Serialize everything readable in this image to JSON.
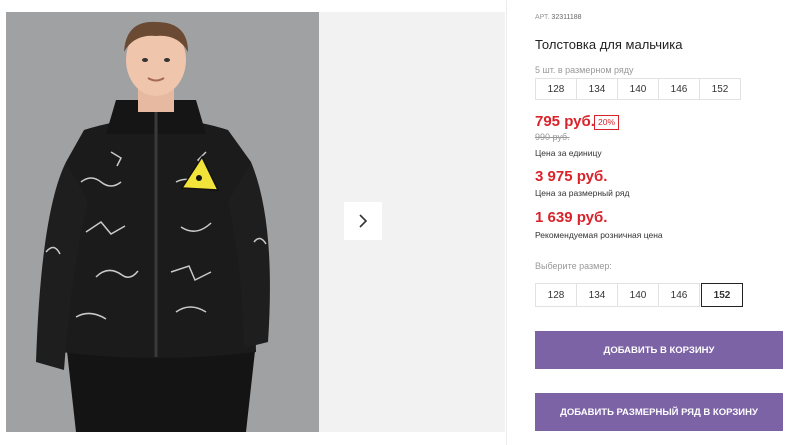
{
  "product": {
    "art_label": "АРТ.",
    "art_number": "32311188",
    "title": "Толстовка для мальчика",
    "row_note": "5 шт. в размерном ряду",
    "row_sizes": [
      "128",
      "134",
      "140",
      "146",
      "152"
    ],
    "unit_price": "795 руб.",
    "discount": "20%",
    "old_price": "990 руб.",
    "unit_price_caption": "Цена за единицу",
    "row_price": "3 975 руб.",
    "row_price_caption": "Цена за размерный ряд",
    "retail_price": "1 639 руб.",
    "retail_price_caption": "Рекомендуемая розничная цена",
    "choose_size_label": "Выберите размер:",
    "select_sizes": [
      "128",
      "134",
      "140",
      "146",
      "152"
    ],
    "selected_size": "152",
    "add_to_cart": "ДОБАВИТЬ В КОРЗИНУ",
    "add_row_to_cart": "ДОБАВИТЬ РАЗМЕРНЫЙ РЯД В КОРЗИНУ"
  },
  "gallery": {
    "next_icon": "chevron-right-icon",
    "photo_icon": "product-photo"
  },
  "colors": {
    "accent": "#7c63a6",
    "price_red": "#d8232a",
    "photo_bg": "#9a9c9e",
    "pane_bg": "#f2f2f2"
  }
}
